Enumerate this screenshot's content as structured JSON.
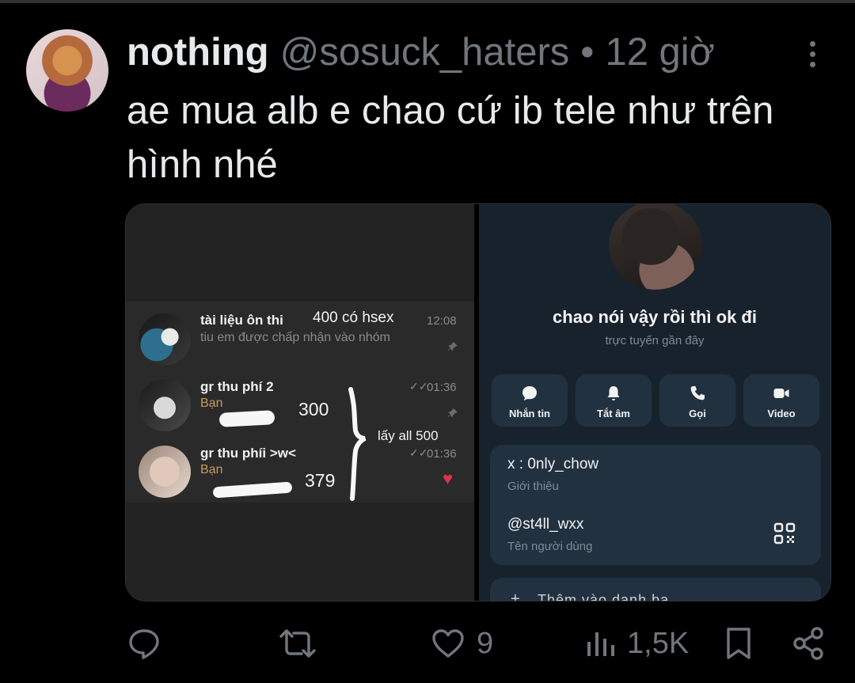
{
  "tweet": {
    "display_name": "nothing",
    "handle": "@sosuck_haters",
    "separator": "•",
    "time": "12 giờ",
    "text": "ae mua alb e chao cứ ib tele như trên hình nhé"
  },
  "chat_list": {
    "rows": [
      {
        "title": "tài liệu ôn thi",
        "subtitle": "tiu em được chấp nhận vào nhóm",
        "time": "12:08",
        "note": "400 có hsex"
      },
      {
        "title": "gr thu phí 2",
        "you_label": "Bạn",
        "time": "01:36",
        "note": "300"
      },
      {
        "title": "gr thu phíi >w<",
        "you_label": "Bạn",
        "time": "01:36",
        "note": "379"
      }
    ],
    "bracket_note": "lấy all 500"
  },
  "profile": {
    "name": "chao nói vậy rồi thì ok đi",
    "status": "trực tuyến gần đây",
    "actions": [
      {
        "label": "Nhắn tin",
        "icon": "chat-bubble-icon"
      },
      {
        "label": "Tắt âm",
        "icon": "bell-icon"
      },
      {
        "label": "Gọi",
        "icon": "phone-icon"
      },
      {
        "label": "Video",
        "icon": "video-camera-icon"
      }
    ],
    "bio": {
      "value": "x : 0nly_chow",
      "label": "Giới thiệu"
    },
    "username": {
      "value": "@st4ll_wxx",
      "label": "Tên người dùng"
    },
    "cut_row_text": "Thêm vào danh bạ"
  },
  "actions_bar": {
    "likes": "9",
    "views": "1,5K"
  },
  "colors": {
    "background": "#000000",
    "text": "#e7e9ea",
    "muted": "#71767b",
    "telegram_panel": "#223140",
    "heart": "#e0304e"
  }
}
